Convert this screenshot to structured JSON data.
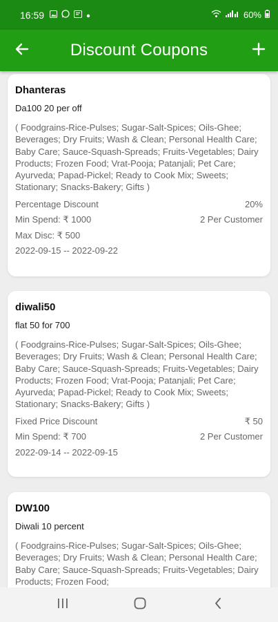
{
  "status_bar": {
    "time": "16:59",
    "battery": "60%",
    "icons": [
      "gallery-icon",
      "whatsapp-icon",
      "message-icon",
      "dot-icon",
      "wifi-icon",
      "signal-icon",
      "battery-icon"
    ]
  },
  "app_bar": {
    "title": "Discount Coupons",
    "back_icon": "arrow-left-icon",
    "add_icon": "plus-icon"
  },
  "coupons": [
    {
      "code": "Dhanteras",
      "description": "Da100 20 per off",
      "categories": "( Foodgrains-Rice-Pulses; Sugar-Salt-Spices; Oils-Ghee; Beverages; Dry Fruits; Wash & Clean; Personal Health Care; Baby Care; Sauce-Squash-Spreads; Fruits-Vegetables; Dairy Products; Frozen Food; Vrat-Pooja; Patanjali; Pet Care; Ayurveda; Papad-Pickel; Ready to Cook Mix; Sweets; Stationary; Snacks-Bakery; Gifts )",
      "type": "Percentage Discount",
      "value": "20%",
      "min_spend": "Min Spend: ₹ 1000",
      "per_customer": "2 Per Customer",
      "max_disc": "Max Disc: ₹ 500",
      "dates": "2022-09-15 -- 2022-09-22"
    },
    {
      "code": "diwali50",
      "description": "flat 50 for 700",
      "categories": "( Foodgrains-Rice-Pulses; Sugar-Salt-Spices; Oils-Ghee; Beverages; Dry Fruits; Wash & Clean; Personal Health Care; Baby Care; Sauce-Squash-Spreads; Fruits-Vegetables; Dairy Products; Frozen Food; Vrat-Pooja; Patanjali; Pet Care; Ayurveda; Papad-Pickel; Ready to Cook Mix; Sweets; Stationary; Snacks-Bakery; Gifts )",
      "type": "Fixed Price Discount",
      "value": "₹ 50",
      "min_spend": "Min Spend: ₹ 700",
      "per_customer": "2 Per Customer",
      "dates": "2022-09-14 -- 2022-09-15"
    },
    {
      "code": "DW100",
      "description": "Diwali 10 percent",
      "categories": "( Foodgrains-Rice-Pulses; Sugar-Salt-Spices; Oils-Ghee; Beverages; Dry Fruits; Wash & Clean; Personal Health Care; Baby Care; Sauce-Squash-Spreads; Fruits-Vegetables; Dairy Products; Frozen Food;"
    }
  ],
  "nav_bar": {
    "icons": [
      "recent-apps-icon",
      "home-icon",
      "back-icon"
    ]
  },
  "colors": {
    "status_bar": "#1a8a12",
    "app_bar": "#229e15",
    "background": "#eeeeee",
    "card": "#ffffff"
  }
}
